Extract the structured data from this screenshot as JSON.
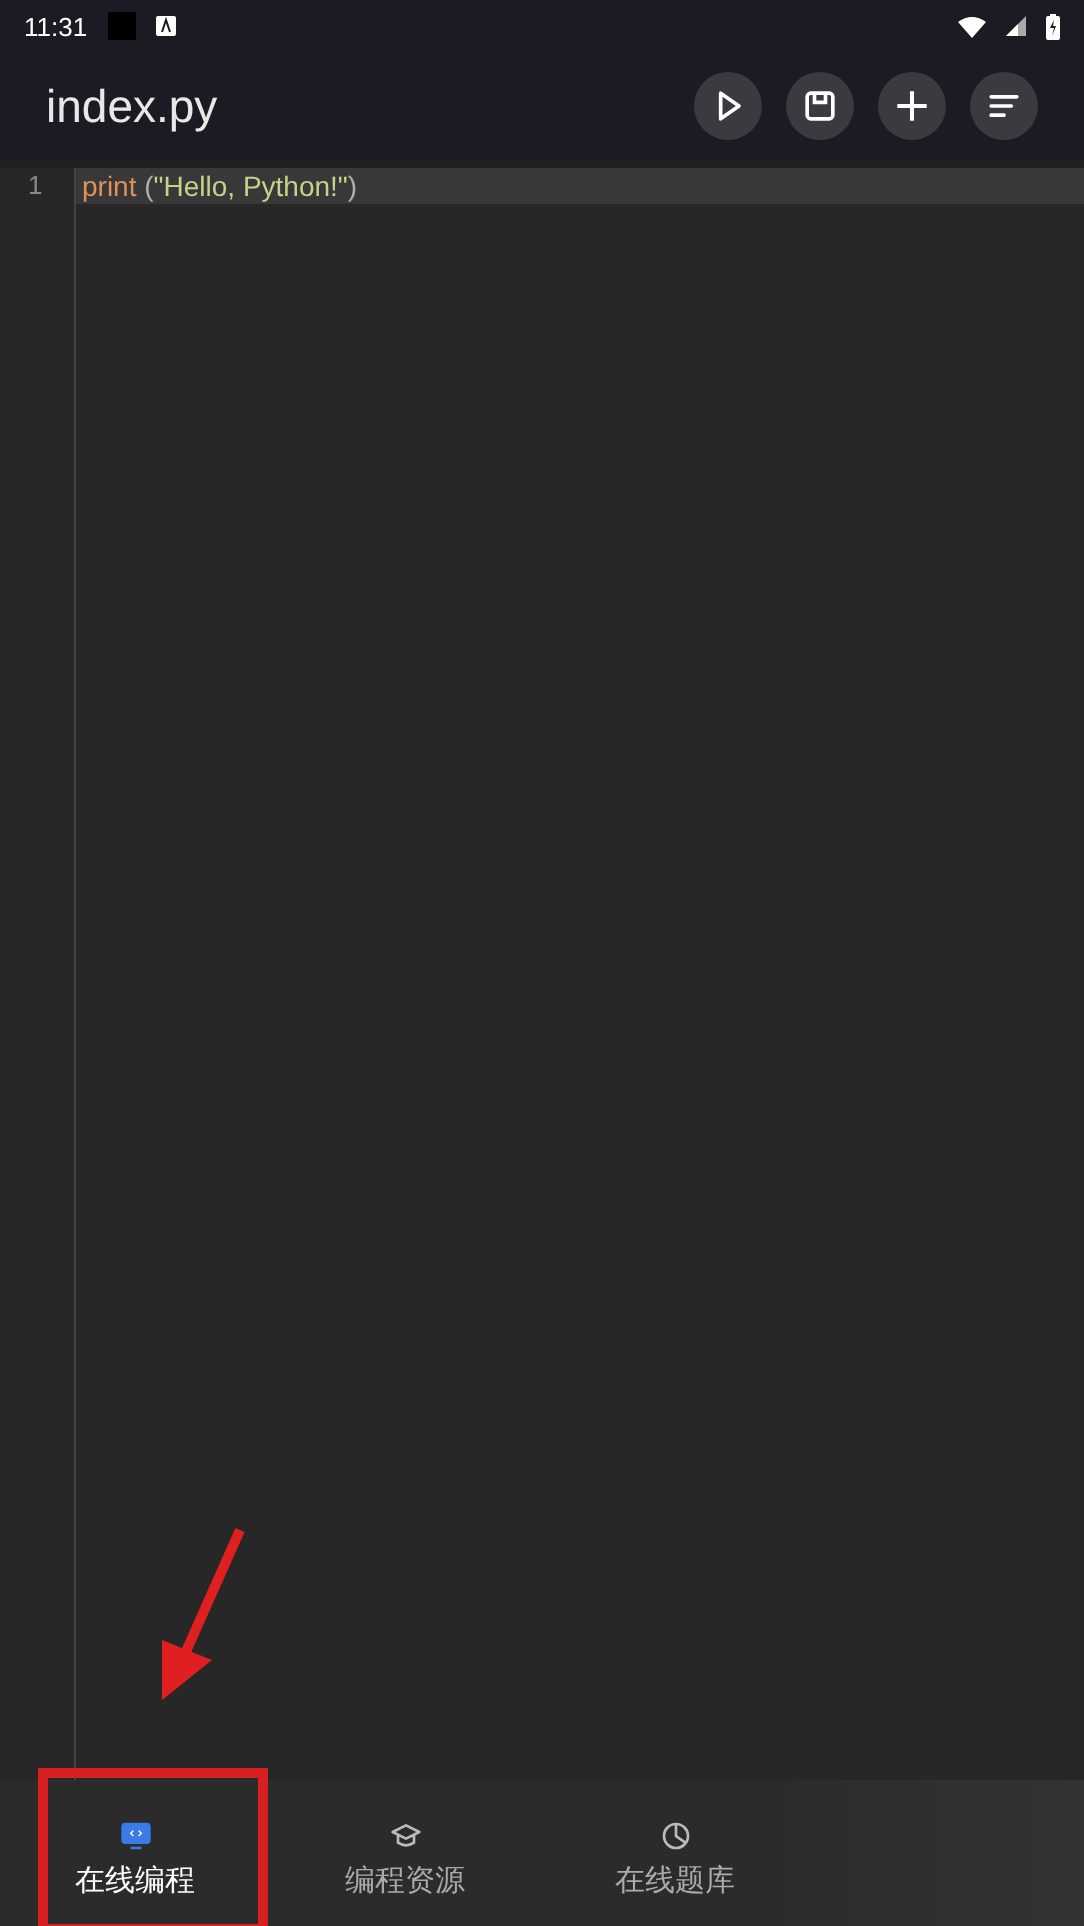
{
  "status_bar": {
    "time": "11:31"
  },
  "header": {
    "title": "index.py",
    "actions": [
      {
        "kind": "run"
      },
      {
        "kind": "save"
      },
      {
        "kind": "add"
      },
      {
        "kind": "format"
      }
    ]
  },
  "editor": {
    "lines": [
      {
        "number": "1",
        "active": true,
        "tokens": [
          {
            "kind": "function",
            "text": "print"
          },
          {
            "kind": "punct",
            "text": " ("
          },
          {
            "kind": "string",
            "text": "\"Hello, Python!\""
          },
          {
            "kind": "punct",
            "text": ")"
          }
        ]
      }
    ]
  },
  "bottom_nav": [
    {
      "kind": "code",
      "label": "在线编程",
      "selected": true
    },
    {
      "kind": "course",
      "label": "编程资源",
      "selected": false
    },
    {
      "kind": "chart",
      "label": "在线题库",
      "selected": false
    }
  ]
}
